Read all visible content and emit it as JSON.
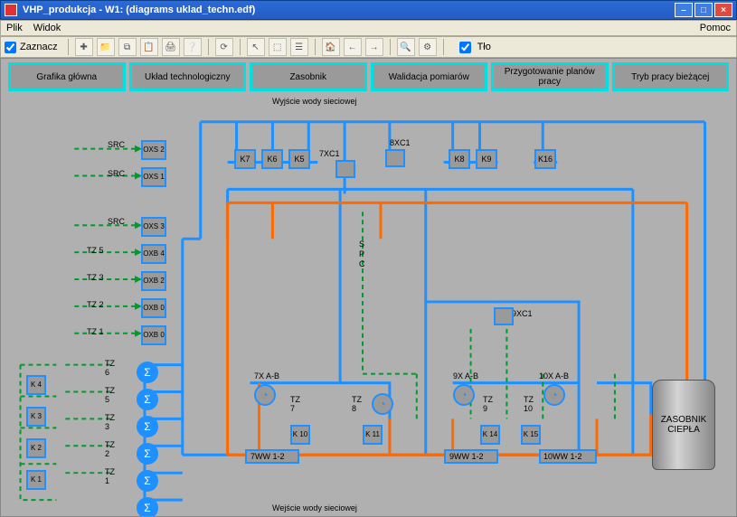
{
  "window": {
    "title": "VHP_produkcja - W1: (diagrams uklad_techn.edf)"
  },
  "menubar": {
    "file": "Plik",
    "view": "Widok",
    "help": "Pomoc"
  },
  "toolbar": {
    "zaznacz": "Zaznacz",
    "tlo": "Tło"
  },
  "nav": {
    "b1": "Grafika główna",
    "b2": "Układ technologiczny",
    "b3": "Zasobnik",
    "b4": "Walidacja pomiarów",
    "b5": "Przygotowanie planów pracy",
    "b6": "Tryb pracy bieżącej"
  },
  "diagram": {
    "top_label": "Wyjście wody sieciowej",
    "bottom_label": "Wejście wody sieciowej",
    "src": "SRC",
    "tz5": "TZ 5",
    "tz3": "TZ 3",
    "tz2": "TZ 2",
    "tz1": "TZ 1",
    "tz6v": "TZ\n6",
    "tz5v": "TZ\n5",
    "tz3v": "TZ\n3",
    "tz2v": "TZ\n2",
    "tz1v": "TZ\n1",
    "tz7v": "TZ\n7",
    "tz8v": "TZ\n8",
    "tz9v": "TZ\n9",
    "tz10v": "TZ\n10",
    "spc": "S\nP\nC",
    "oxs2": "OXS\n2",
    "oxs1": "OXS\n1",
    "oxs3": "OXS\n3",
    "oxb4": "OXB\n4",
    "oxb2": "OXB\n2",
    "oxb0a": "OXB\n0",
    "oxb0b": "OXB\n0",
    "k7": "K7",
    "k6": "K6",
    "k5": "K5",
    "k8": "K8",
    "k9": "K9",
    "k16": "K16",
    "k4s": "K\n4",
    "k3s": "K\n3",
    "k2s": "K\n2",
    "k1s": "K\n1",
    "k10s": "K\n10",
    "k11s": "K\n11",
    "k14s": "K\n14",
    "k15s": "K\n15",
    "xc7": "7XC1",
    "xc8": "8XC1",
    "xc9": "9XC1",
    "ab7": "7X A-B",
    "ab9": "9X A-B",
    "ab10": "10X A-B",
    "ww7": "7WW 1-2",
    "ww9": "9WW 1-2",
    "ww10": "10WW 1-2",
    "tank": "ZASOBNIK CIEPŁA"
  }
}
